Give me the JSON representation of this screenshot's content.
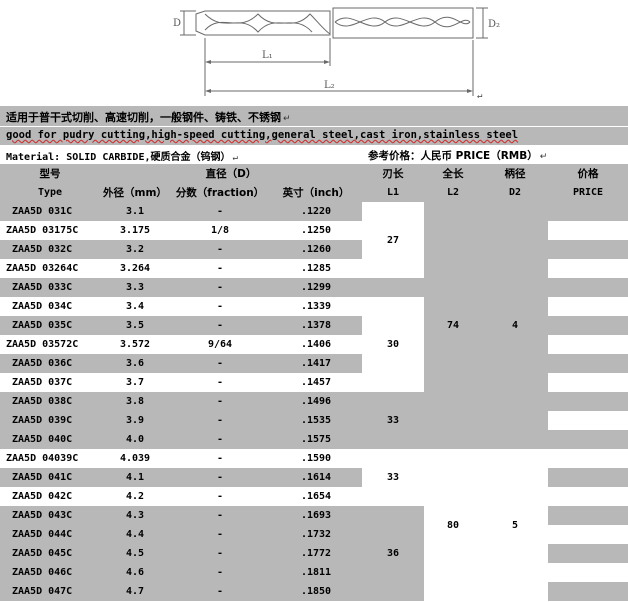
{
  "drawing": {
    "labels": {
      "d": "D",
      "d2": "D₂",
      "l1": "L₁",
      "l2": "L₂"
    }
  },
  "notes": {
    "line1": "适用于普干式切削、高速切削，一般钢件、铸铁、不锈钢",
    "line2": "good for pudry cutting,high-speed cutting,general steel,cast iron,stainless steel",
    "material": "Material: SOLID CARBIDE,硬质合金（钨钢）",
    "price_ref": "参考价格：人民币 PRICE（RMB）"
  },
  "headers": {
    "row1": {
      "model": "型号",
      "diameter": "直径（D）",
      "flute": "刃长",
      "length": "全长",
      "shank": "柄径",
      "price": "价格"
    },
    "row2": {
      "type": "Type",
      "od": "外径（mm）",
      "fraction": "分数（fraction）",
      "inch": "英寸（inch）",
      "l1": "L1",
      "l2": "L2",
      "d2": "D2",
      "price": "PRICE"
    }
  },
  "marks": {
    "return": "↵"
  },
  "rows": [
    {
      "code": "ZAA5D 031C",
      "mm": "3.1",
      "frac": "-",
      "inch": ".1220"
    },
    {
      "code": "ZAA5D 03175C",
      "mm": "3.175",
      "frac": "1/8",
      "inch": ".1250"
    },
    {
      "code": "ZAA5D 032C",
      "mm": "3.2",
      "frac": "-",
      "inch": ".1260"
    },
    {
      "code": "ZAA5D 03264C",
      "mm": "3.264",
      "frac": "-",
      "inch": ".1285"
    },
    {
      "code": "ZAA5D 033C",
      "mm": "3.3",
      "frac": "-",
      "inch": ".1299"
    },
    {
      "code": "ZAA5D 034C",
      "mm": "3.4",
      "frac": "-",
      "inch": ".1339"
    },
    {
      "code": "ZAA5D 035C",
      "mm": "3.5",
      "frac": "-",
      "inch": ".1378"
    },
    {
      "code": "ZAA5D 03572C",
      "mm": "3.572",
      "frac": "9/64",
      "inch": ".1406"
    },
    {
      "code": "ZAA5D 036C",
      "mm": "3.6",
      "frac": "-",
      "inch": ".1417"
    },
    {
      "code": "ZAA5D 037C",
      "mm": "3.7",
      "frac": "-",
      "inch": ".1457"
    },
    {
      "code": "ZAA5D 038C",
      "mm": "3.8",
      "frac": "-",
      "inch": ".1496"
    },
    {
      "code": "ZAA5D 039C",
      "mm": "3.9",
      "frac": "-",
      "inch": ".1535"
    },
    {
      "code": "ZAA5D 040C",
      "mm": "4.0",
      "frac": "-",
      "inch": ".1575"
    },
    {
      "code": "ZAA5D 04039C",
      "mm": "4.039",
      "frac": "-",
      "inch": ".1590"
    },
    {
      "code": "ZAA5D 041C",
      "mm": "4.1",
      "frac": "-",
      "inch": ".1614"
    },
    {
      "code": "ZAA5D 042C",
      "mm": "4.2",
      "frac": "-",
      "inch": ".1654"
    },
    {
      "code": "ZAA5D 043C",
      "mm": "4.3",
      "frac": "-",
      "inch": ".1693"
    },
    {
      "code": "ZAA5D 044C",
      "mm": "4.4",
      "frac": "-",
      "inch": ".1732"
    },
    {
      "code": "ZAA5D 045C",
      "mm": "4.5",
      "frac": "-",
      "inch": ".1772"
    },
    {
      "code": "ZAA5D 046C",
      "mm": "4.6",
      "frac": "-",
      "inch": ".1811"
    },
    {
      "code": "ZAA5D 047C",
      "mm": "4.7",
      "frac": "-",
      "inch": ".1850"
    }
  ],
  "groups": {
    "l1": [
      "27",
      "30",
      "33",
      "33",
      "36"
    ],
    "l2": [
      "74",
      "80"
    ],
    "d2": [
      "4",
      "5"
    ]
  }
}
